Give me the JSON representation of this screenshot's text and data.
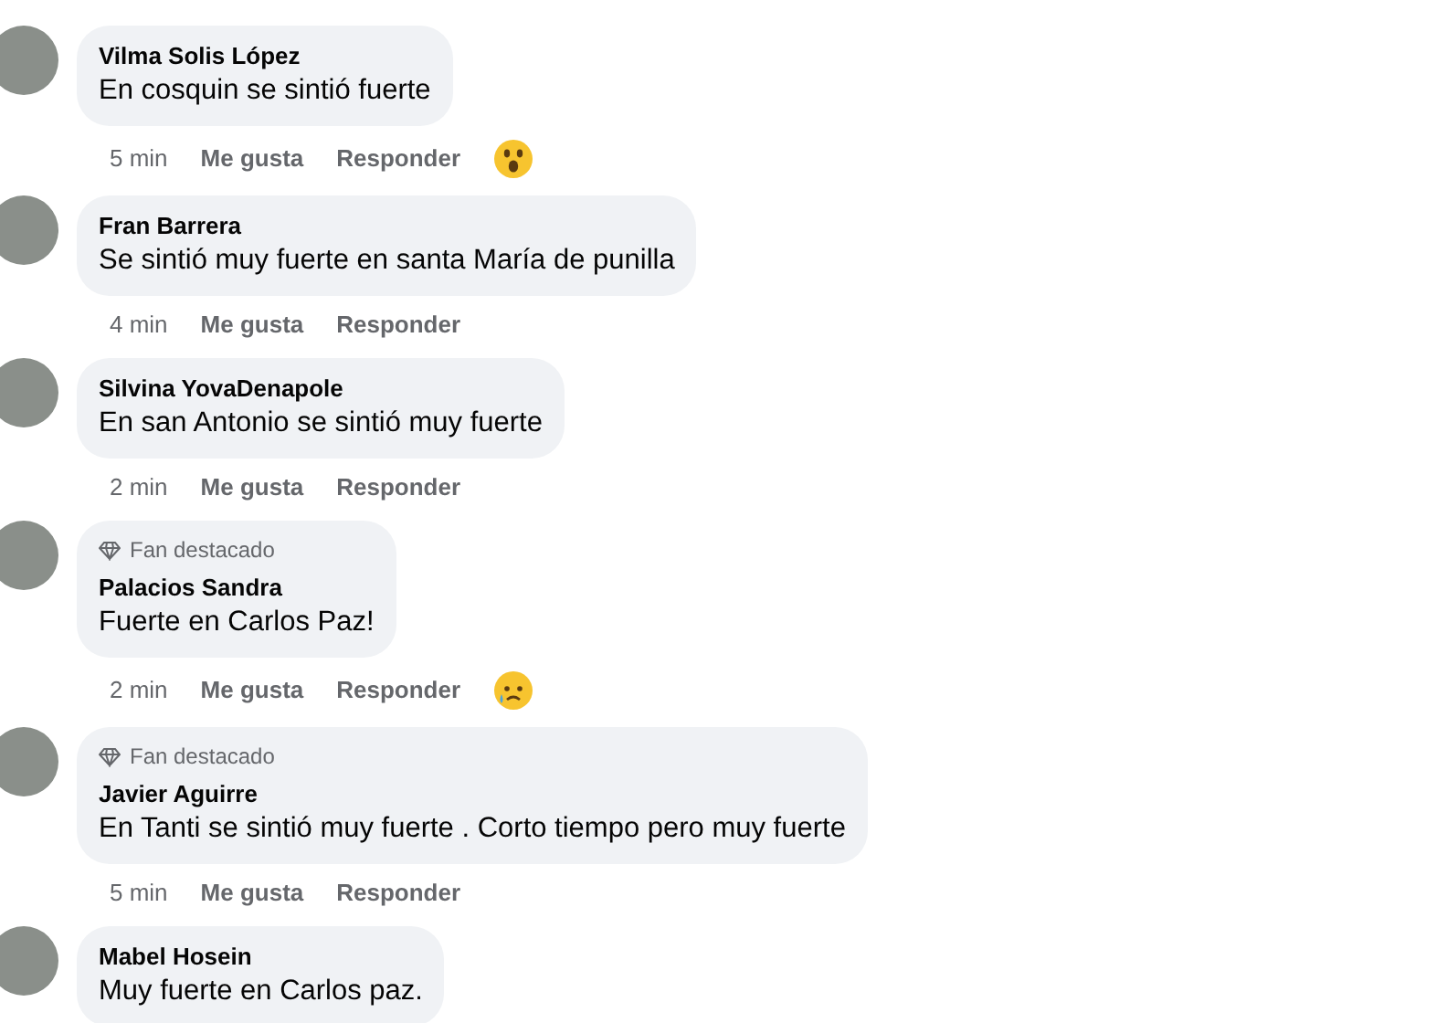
{
  "comments": [
    {
      "author": "Vilma Solis López",
      "text": "En cosquin se sintió fuerte",
      "time": "5 min",
      "like": "Me gusta",
      "reply": "Responder",
      "reaction": {
        "kind": "wow"
      }
    },
    {
      "author": "Fran Barrera",
      "text": "Se sintió muy fuerte en santa María de punilla",
      "time": "4 min",
      "like": "Me gusta",
      "reply": "Responder"
    },
    {
      "author": "Silvina YovaDenapole",
      "text": "En san Antonio se sintió muy fuerte",
      "time": "2 min",
      "like": "Me gusta",
      "reply": "Responder"
    },
    {
      "badge": "Fan destacado",
      "author": "Palacios Sandra",
      "text": "Fuerte en Carlos Paz!",
      "time": "2 min",
      "like": "Me gusta",
      "reply": "Responder",
      "reaction": {
        "kind": "sad"
      }
    },
    {
      "badge": "Fan destacado",
      "author": "Javier Aguirre",
      "text": "En Tanti se sintió muy fuerte . Corto tiempo pero muy fuerte",
      "time": "5 min",
      "like": "Me gusta",
      "reply": "Responder"
    },
    {
      "author": "Mabel Hosein",
      "text": "Muy fuerte en Carlos paz."
    }
  ]
}
